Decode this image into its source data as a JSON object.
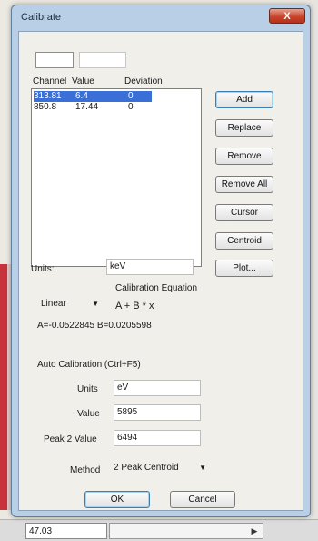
{
  "window": {
    "title": "Calibrate",
    "close_label": "X"
  },
  "top_inputs": {
    "left_value": "",
    "right_value": ""
  },
  "list": {
    "headers": {
      "channel": "Channel",
      "value": "Value",
      "deviation": "Deviation"
    },
    "rows": [
      {
        "channel": "313.81",
        "value": "6.4",
        "deviation": "0",
        "selected": true
      },
      {
        "channel": "850.8",
        "value": "17.44",
        "deviation": "0",
        "selected": false
      }
    ]
  },
  "buttons": {
    "add": "Add",
    "replace": "Replace",
    "remove": "Remove",
    "remove_all": "Remove All",
    "cursor": "Cursor",
    "centroid": "Centroid",
    "plot": "Plot...",
    "ok": "OK",
    "cancel": "Cancel"
  },
  "units": {
    "label": "Units:",
    "value": "keV"
  },
  "equation": {
    "heading": "Calibration Equation",
    "type": "Linear",
    "formula": "A + B * x",
    "coefficients": "A=-0.0522845 B=0.0205598"
  },
  "auto": {
    "heading": "Auto Calibration (Ctrl+F5)",
    "units_label": "Units",
    "units_value": "eV",
    "value_label": "Value",
    "value_value": "5895",
    "peak2_label": "Peak 2 Value",
    "peak2_value": "6494",
    "method_label": "Method",
    "method_value": "2 Peak Centroid"
  },
  "background": {
    "cell_value": "47.03"
  }
}
